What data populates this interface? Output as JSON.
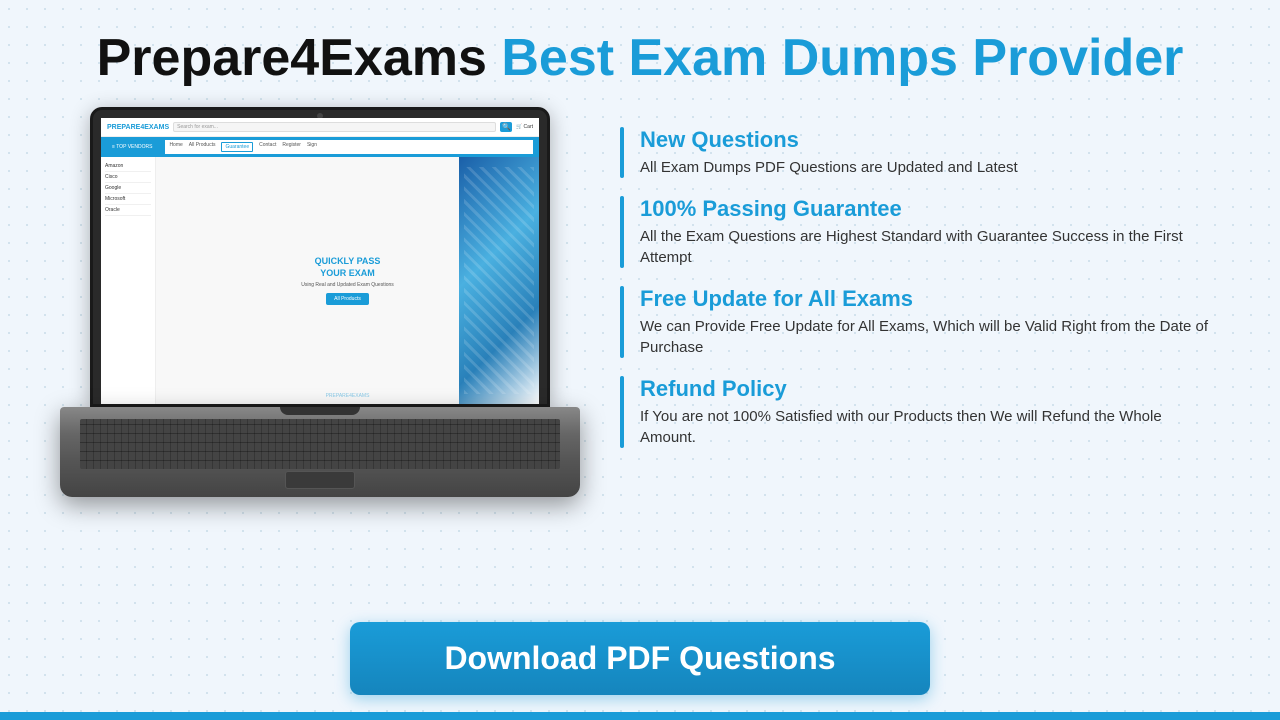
{
  "header": {
    "brand": "Prepare4Exams",
    "tagline": "Best Exam Dumps Provider"
  },
  "features": [
    {
      "id": "new-questions",
      "title": "New Questions",
      "description": "All Exam Dumps PDF Questions are Updated and Latest"
    },
    {
      "id": "passing-guarantee",
      "title": "100% Passing Guarantee",
      "description": "All the Exam Questions are Highest Standard with Guarantee Success in the First Attempt"
    },
    {
      "id": "free-update",
      "title": "Free Update for All Exams",
      "description": "We can Provide Free Update for All Exams, Which will be Valid Right from the Date of Purchase"
    },
    {
      "id": "refund-policy",
      "title": "Refund Policy",
      "description": "If You are not 100% Satisfied with our Products then We will Refund the Whole Amount."
    }
  ],
  "mockup": {
    "logo": "PREPARE4EXAMS",
    "search_placeholder": "Search for exam...",
    "nav_items": [
      "Home",
      "All Products",
      "Guarantee",
      "Contact",
      "Register",
      "Sign"
    ],
    "sidebar_items": [
      "Amazon",
      "Cisco",
      "Google",
      "Microsoft",
      "Oracle"
    ],
    "hero_text": "QUICKLY PASS\nYOUR EXAM",
    "hero_sub": "Using Real and Updated Exam Questions",
    "all_products_btn": "All Products",
    "watermark": "PREPARE4EXAMS",
    "cart_label": "Cart"
  },
  "download": {
    "button_label": "Download PDF Questions"
  },
  "colors": {
    "blue": "#1a9cd8",
    "dark": "#111111",
    "body_bg": "#f0f6fc"
  }
}
